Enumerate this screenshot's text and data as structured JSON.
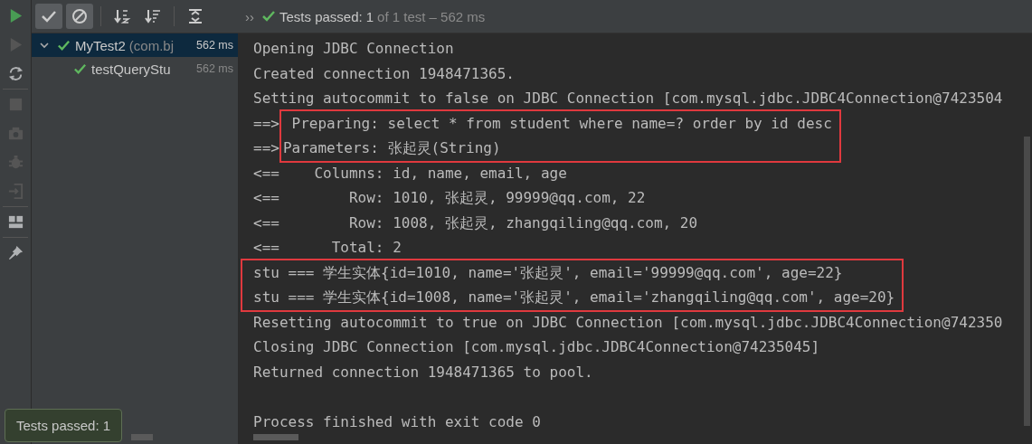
{
  "side_toolbar": [
    {
      "kind": "run",
      "disabled": false
    },
    {
      "kind": "rerun_failed",
      "disabled": true
    },
    {
      "kind": "auto_test",
      "disabled": false
    },
    {
      "kind": "stop",
      "disabled": true
    },
    {
      "kind": "camera",
      "disabled": true
    },
    {
      "kind": "debug_export",
      "disabled": true
    },
    {
      "kind": "import",
      "disabled": true
    },
    {
      "kind": "layout",
      "disabled": false
    },
    {
      "kind": "pin",
      "disabled": false
    }
  ],
  "toolbar": [
    {
      "kind": "show_passed",
      "on": true
    },
    {
      "kind": "show_ignored",
      "on": true
    },
    {
      "kind": "sort_alpha",
      "on": false
    },
    {
      "kind": "sort_duration",
      "on": false
    },
    {
      "kind": "expand_all",
      "on": false
    }
  ],
  "more": "››",
  "status": {
    "label": "Tests passed:",
    "count": "1",
    "detail": "of 1 test – 562 ms"
  },
  "tree": [
    {
      "name": "MyTest2",
      "package": "(com.bj",
      "time": "562 ms",
      "passed": true,
      "selected": true,
      "expanded": true,
      "children": [
        {
          "name": "testQueryStu",
          "time": "562 ms",
          "passed": true,
          "selected": false
        }
      ]
    }
  ],
  "console": [
    {
      "highlighted": false,
      "lines": [
        {
          "text": "Opening JDBC Connection"
        },
        {
          "text": "Created connection 1948471365."
        },
        {
          "text": "Setting autocommit to false on JDBC Connection [com.mysql.jdbc.JDBC4Connection@7423504"
        }
      ]
    },
    {
      "highlighted": true,
      "prefix": "==>",
      "lines": [
        {
          "text": " Preparing: select * from student where name=? order by id desc"
        },
        {
          "text": "Parameters: 张起灵(String)"
        }
      ]
    },
    {
      "highlighted": false,
      "lines": [
        {
          "text": "<==    Columns: id, name, email, age"
        },
        {
          "text": "<==        Row: 1010, 张起灵, 99999@qq.com, 22"
        },
        {
          "text": "<==        Row: 1008, 张起灵, zhangqiling@qq.com, 20"
        },
        {
          "text": "<==      Total: 2"
        }
      ]
    },
    {
      "highlighted": true,
      "lines": [
        {
          "text": "stu === 学生实体{id=1010, name='张起灵', email='99999@qq.com', age=22}"
        },
        {
          "text": "stu === 学生实体{id=1008, name='张起灵', email='zhangqiling@qq.com', age=20}"
        }
      ]
    },
    {
      "highlighted": false,
      "lines": [
        {
          "text": "Resetting autocommit to true on JDBC Connection [com.mysql.jdbc.JDBC4Connection@742350"
        },
        {
          "text": "Closing JDBC Connection [com.mysql.jdbc.JDBC4Connection@74235045]"
        },
        {
          "text": "Returned connection 1948471365 to pool."
        }
      ]
    },
    {
      "highlighted": false,
      "spaced": true,
      "lines": [
        {
          "text": "Process finished with exit code 0"
        }
      ]
    }
  ],
  "toast": {
    "text": "Tests passed: 1"
  }
}
